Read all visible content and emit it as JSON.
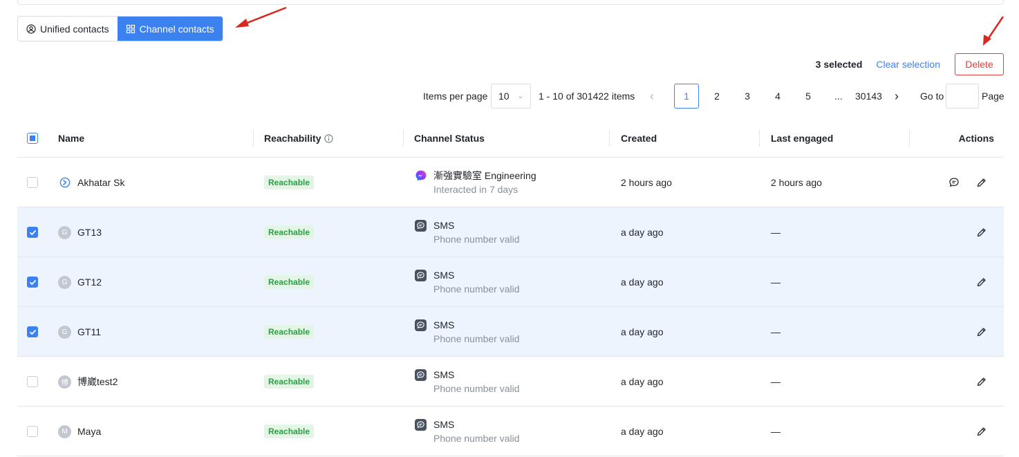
{
  "tabs": [
    {
      "label": "Unified contacts",
      "icon": "user-circle-icon",
      "active": false
    },
    {
      "label": "Channel contacts",
      "icon": "grid-icon",
      "active": true
    }
  ],
  "selection": {
    "count_text": "3 selected",
    "clear_label": "Clear selection",
    "delete_label": "Delete"
  },
  "pagination": {
    "items_per_page_label": "Items per page",
    "items_per_page": "10",
    "range_text": "1 - 10 of 301422 items",
    "pages": [
      "1",
      "2",
      "3",
      "4",
      "5",
      "...",
      "30143"
    ],
    "current_page": "1",
    "goto_label": "Go to",
    "page_label": "Page"
  },
  "table": {
    "columns": {
      "name": "Name",
      "reachability": "Reachability",
      "channel_status": "Channel Status",
      "created": "Created",
      "last_engaged": "Last engaged",
      "actions": "Actions"
    },
    "rows": [
      {
        "name": "Akhatar Sk",
        "avatar": "",
        "avatar_type": "messenger-icon",
        "reachability": "Reachable",
        "channel_icon": "messenger-icon",
        "channel": "漸強實驗室 Engineering",
        "channel_sub": "Interacted in 7 days",
        "created": "2 hours ago",
        "last_engaged": "2 hours ago",
        "checked": false,
        "has_chat": true
      },
      {
        "name": "GT13",
        "avatar": "G",
        "reachability": "Reachable",
        "channel_icon": "sms-icon",
        "channel": "SMS",
        "channel_sub": "Phone number valid",
        "created": "a day ago",
        "last_engaged": "—",
        "checked": true,
        "has_chat": false
      },
      {
        "name": "GT12",
        "avatar": "G",
        "reachability": "Reachable",
        "channel_icon": "sms-icon",
        "channel": "SMS",
        "channel_sub": "Phone number valid",
        "created": "a day ago",
        "last_engaged": "—",
        "checked": true,
        "has_chat": false
      },
      {
        "name": "GT11",
        "avatar": "G",
        "reachability": "Reachable",
        "channel_icon": "sms-icon",
        "channel": "SMS",
        "channel_sub": "Phone number valid",
        "created": "a day ago",
        "last_engaged": "—",
        "checked": true,
        "has_chat": false
      },
      {
        "name": "博崴test2",
        "avatar": "博",
        "reachability": "Reachable",
        "channel_icon": "sms-icon",
        "channel": "SMS",
        "channel_sub": "Phone number valid",
        "created": "a day ago",
        "last_engaged": "—",
        "checked": false,
        "has_chat": false
      },
      {
        "name": "Maya",
        "avatar": "M",
        "reachability": "Reachable",
        "channel_icon": "sms-icon",
        "channel": "SMS",
        "channel_sub": "Phone number valid",
        "created": "a day ago",
        "last_engaged": "—",
        "checked": false,
        "has_chat": false
      }
    ]
  },
  "colors": {
    "accent": "#3b82f0",
    "danger": "#e23c39",
    "annotation_arrow": "#d9281e"
  }
}
